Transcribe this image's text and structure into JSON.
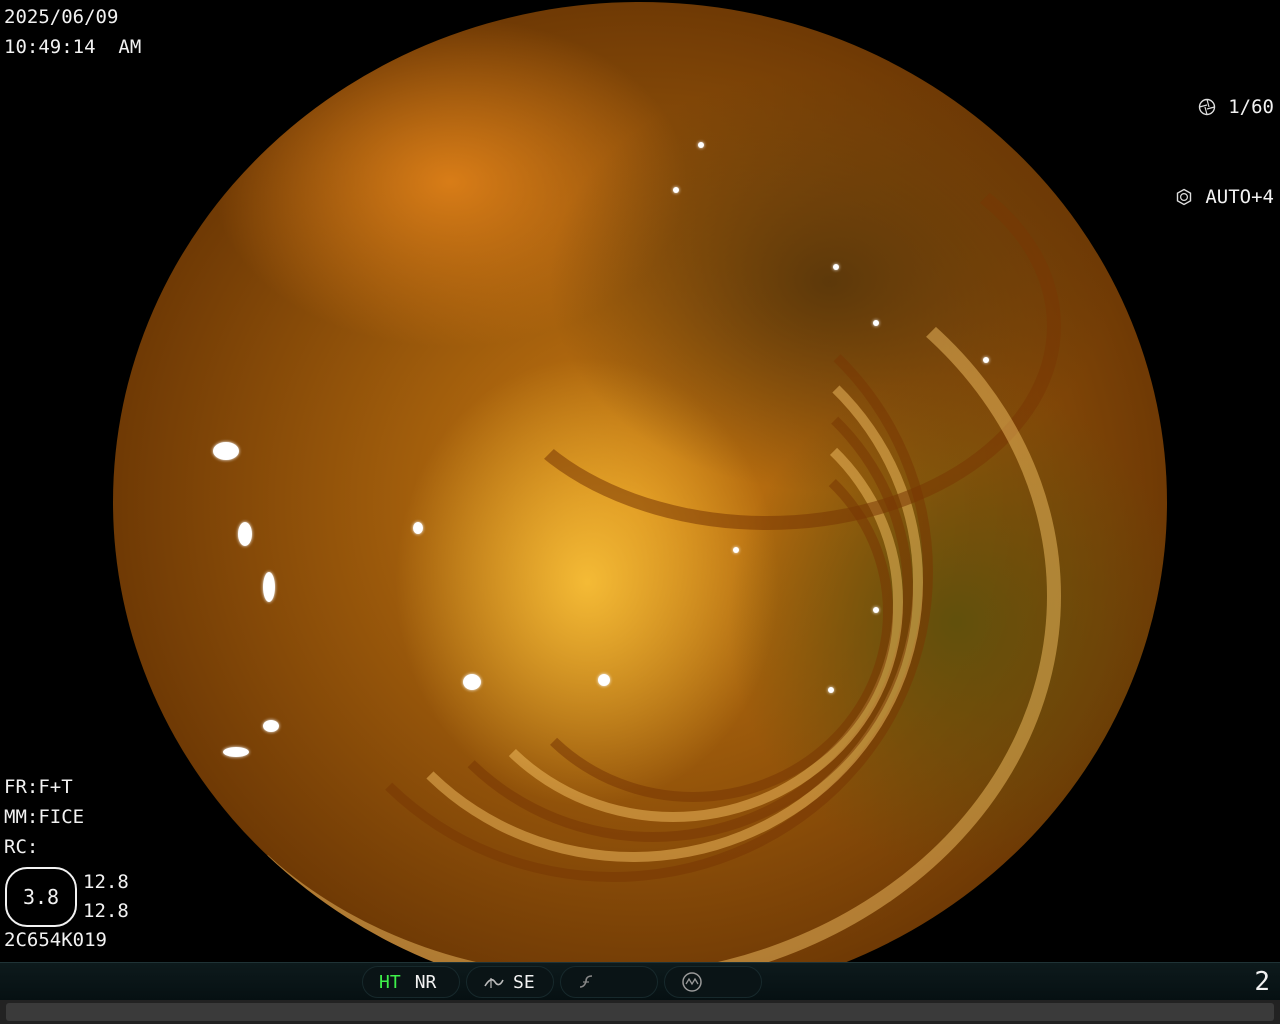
{
  "overlay": {
    "date": "2025/06/09",
    "time": "10:49:14  AM",
    "shutter": "1/60",
    "exposure": "AUTO+4",
    "fr": "FR:F+T",
    "mm": "MM:FICE",
    "rc": "RC:",
    "zoom_value": "3.8",
    "zoom_a": "12.8",
    "zoom_b": "12.8",
    "serial": "2C654K019"
  },
  "status_bar": {
    "ht": "HT",
    "nr": "NR",
    "se": "SE",
    "page": "2"
  },
  "icons": {
    "shutter": "aperture-icon",
    "exposure": "exposure-icon",
    "se": "structure-enhance-icon",
    "edge": "edge-icon",
    "mode": "mode-dial-icon"
  },
  "colors": {
    "ht_active": "#3ef04a",
    "bar_bg": "#0a1416"
  }
}
